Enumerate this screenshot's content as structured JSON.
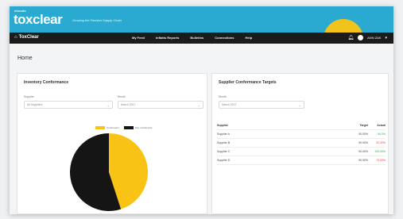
{
  "brand": {
    "small": "elevate",
    "logo": "toxclear",
    "tagline": "Growing the Fashion Supply Chain"
  },
  "nav": {
    "app_name": "ToxClear",
    "links": [
      "My Feed",
      "Inflatts Reports",
      "Bulletins",
      "Connections",
      "Help"
    ],
    "user": "ANN ZAK"
  },
  "page_title": "Home",
  "inventory_conformance": {
    "title": "Inventory Conformance",
    "supplier_label": "Supplier",
    "supplier_value": "All Suppliers",
    "month_label": "Month",
    "month_value": "March 2017",
    "legend": [
      "Conformant",
      "Non-conformant"
    ]
  },
  "supplier_targets": {
    "title": "Supplier Conformance Targets",
    "month_label": "Month",
    "month_value": "March 2017",
    "headers": {
      "supplier": "Supplier",
      "target": "Target",
      "actual": "Actual"
    },
    "rows": [
      {
        "supplier": "Supplier A",
        "target": "90.00%",
        "actual": "94.0%",
        "status": "good"
      },
      {
        "supplier": "Supplier B",
        "target": "90.00%",
        "actual": "20.33%",
        "status": "bad"
      },
      {
        "supplier": "Supplier C",
        "target": "90.00%",
        "actual": "100.00%",
        "status": "good"
      },
      {
        "supplier": "Supplier D",
        "target": "90.00%",
        "actual": "70.00%",
        "status": "bad"
      }
    ]
  },
  "colors": {
    "brand_blue": "#2aaad0",
    "accent_yellow": "#f8c315",
    "dark": "#151515",
    "good": "#2fa84f",
    "bad": "#e0413a"
  },
  "chart_data": {
    "type": "pie",
    "labels": [
      "Conformant",
      "Non-conformant"
    ],
    "values": [
      45,
      55
    ],
    "colors": [
      "#f8c315",
      "#151515"
    ]
  }
}
